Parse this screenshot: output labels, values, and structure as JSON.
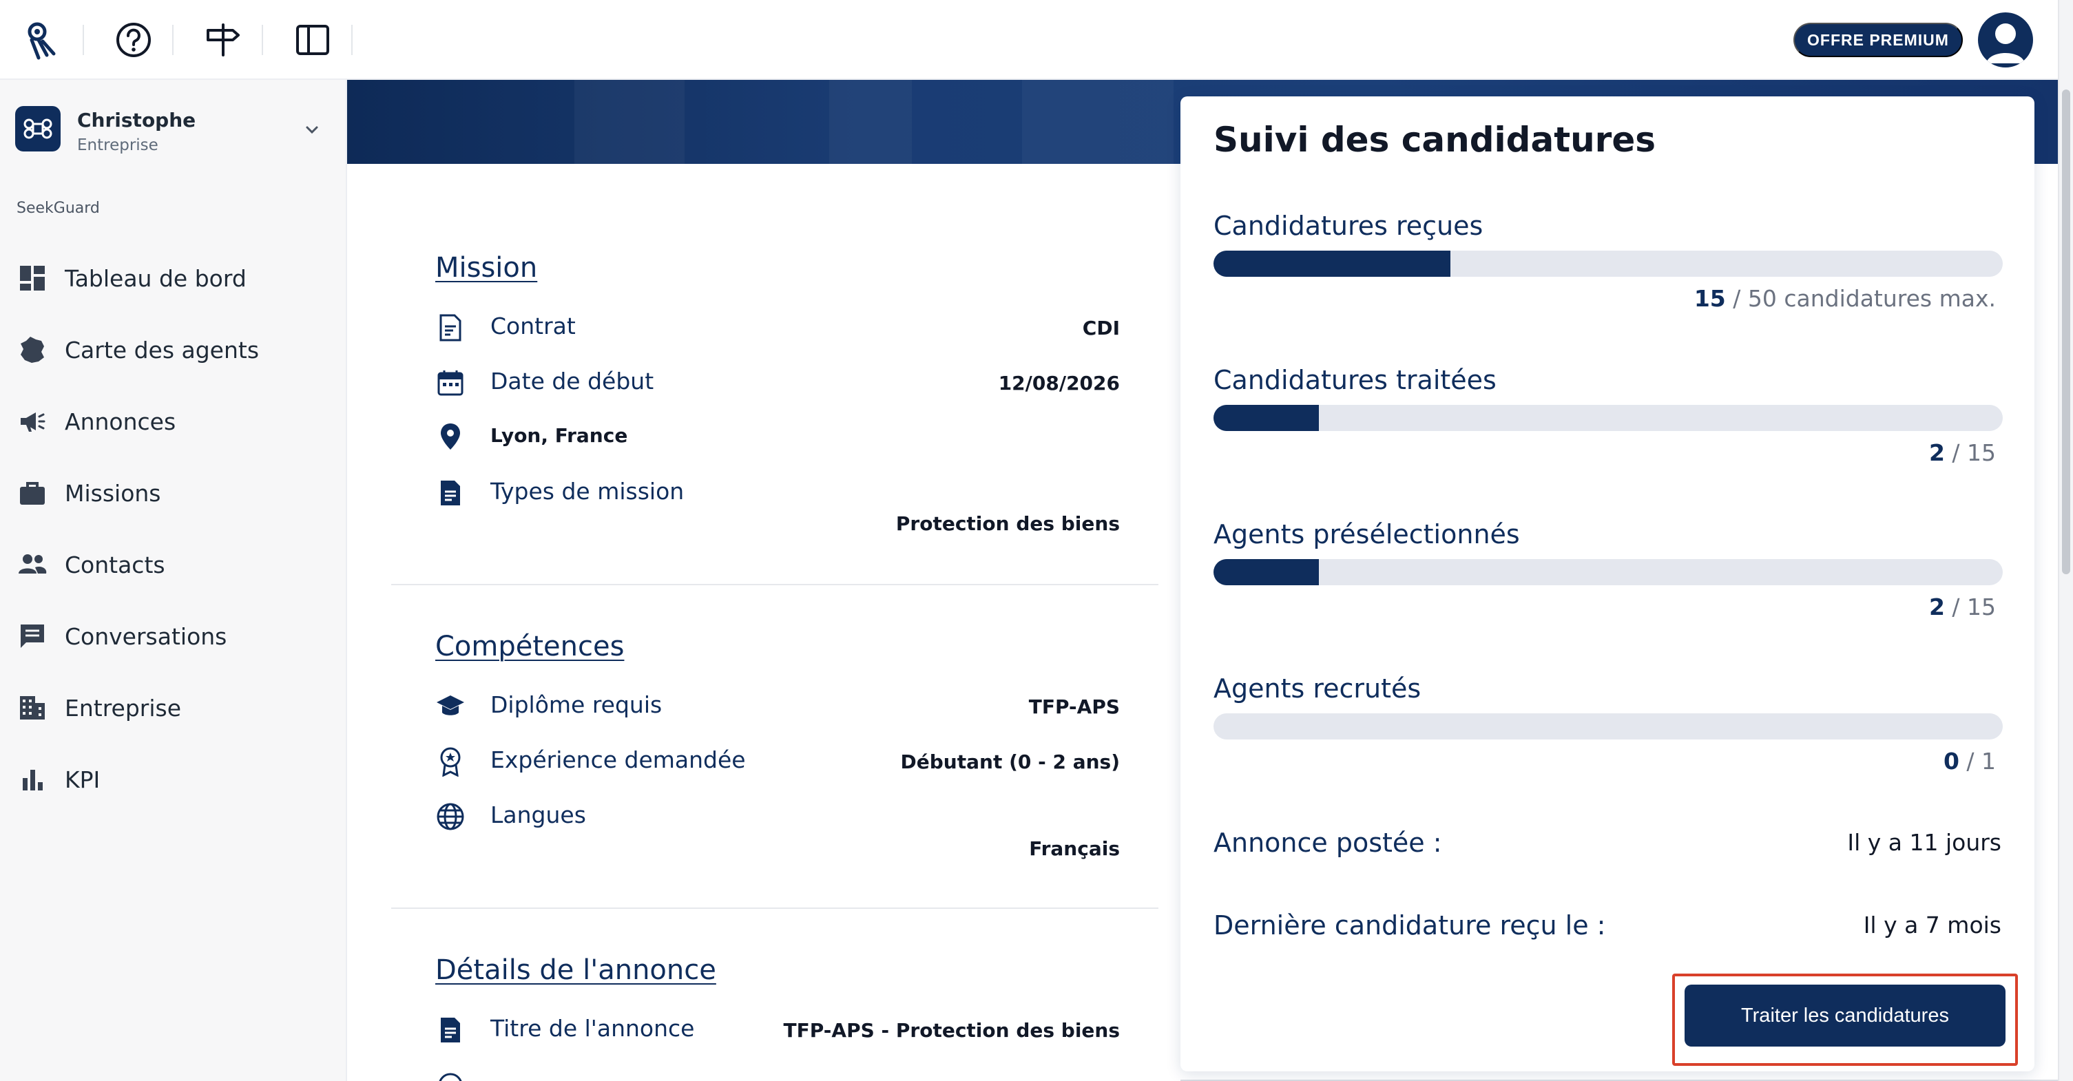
{
  "topbar": {
    "premium_label": "OFFRE PREMIUM"
  },
  "sidebar": {
    "org_name": "Christophe",
    "org_type": "Entreprise",
    "section_label": "SeekGuard",
    "items": [
      {
        "label": "Tableau de bord",
        "icon": "dashboard-icon"
      },
      {
        "label": "Carte des agents",
        "icon": "map-france-icon"
      },
      {
        "label": "Annonces",
        "icon": "megaphone-icon"
      },
      {
        "label": "Missions",
        "icon": "briefcase-icon"
      },
      {
        "label": "Contacts",
        "icon": "people-icon"
      },
      {
        "label": "Conversations",
        "icon": "chat-icon"
      },
      {
        "label": "Entreprise",
        "icon": "building-icon"
      },
      {
        "label": "KPI",
        "icon": "bar-chart-icon"
      }
    ]
  },
  "mission": {
    "title": "Mission",
    "contrat_label": "Contrat",
    "contrat_value": "CDI",
    "date_label": "Date de début",
    "date_value": "12/08/2026",
    "location": "Lyon, France",
    "types_label": "Types de mission",
    "types_value": "Protection des biens"
  },
  "competences": {
    "title": "Compétences",
    "diplome_label": "Diplôme requis",
    "diplome_value": "TFP-APS",
    "experience_label": "Expérience demandée",
    "experience_value": "Débutant (0 - 2 ans)",
    "langues_label": "Langues",
    "langues_value": "Français"
  },
  "details": {
    "title": "Détails de l'annonce",
    "titre_label": "Titre de l'annonce",
    "titre_value": "TFP-APS - Protection des biens"
  },
  "suivi": {
    "title": "Suivi des candidatures",
    "metrics": [
      {
        "label": "Candidatures reçues",
        "value": 15,
        "max": 50,
        "count_num": "15",
        "count_rest": " / 50 candidatures max."
      },
      {
        "label": "Candidatures traitées",
        "value": 2,
        "max": 15,
        "count_num": "2",
        "count_rest": " / 15"
      },
      {
        "label": "Agents présélectionnés",
        "value": 2,
        "max": 15,
        "count_num": "2",
        "count_rest": " / 15"
      },
      {
        "label": "Agents recrutés",
        "value": 0,
        "max": 1,
        "count_num": "0",
        "count_rest": " / 1"
      }
    ],
    "posted_label": "Annonce postée :",
    "posted_value": "Il y a 11 jours",
    "last_label": "Dernière candidature reçu le :",
    "last_value": "Il y a 7 mois",
    "cta_label": "Traiter les candidatures"
  },
  "colors": {
    "primary": "#0f2d5c",
    "track": "#e4e7ee",
    "highlight": "#d9402a"
  }
}
